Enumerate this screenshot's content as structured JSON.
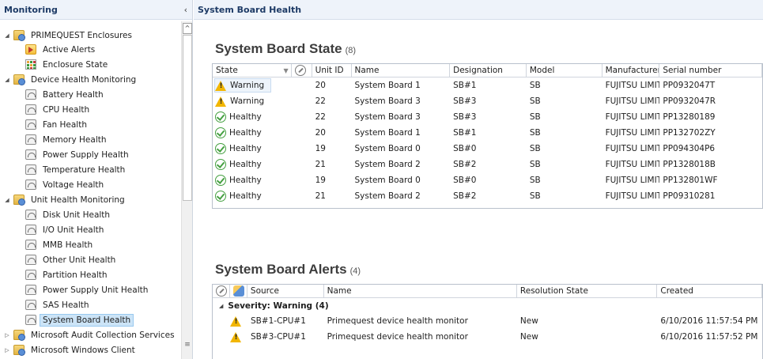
{
  "nav": {
    "title": "Monitoring",
    "collapse_glyph": "‹",
    "tree": [
      {
        "label": "PRIMEQUEST Enclosures",
        "icon": "folder-icon",
        "expander": "◢"
      },
      {
        "label": "Active Alerts",
        "icon": "alert-view-icon"
      },
      {
        "label": "Enclosure State",
        "icon": "state-view-icon"
      },
      {
        "label": "Device Health Monitoring",
        "icon": "folder-icon",
        "expander": "◢"
      },
      {
        "label": "Battery Health",
        "icon": "dashboard-icon"
      },
      {
        "label": "CPU Health",
        "icon": "dashboard-icon"
      },
      {
        "label": "Fan Health",
        "icon": "dashboard-icon"
      },
      {
        "label": "Memory Health",
        "icon": "dashboard-icon"
      },
      {
        "label": "Power Supply Health",
        "icon": "dashboard-icon"
      },
      {
        "label": "Temperature Health",
        "icon": "dashboard-icon"
      },
      {
        "label": "Voltage Health",
        "icon": "dashboard-icon"
      },
      {
        "label": "Unit Health Monitoring",
        "icon": "folder-icon",
        "expander": "◢"
      },
      {
        "label": "Disk Unit Health",
        "icon": "dashboard-icon"
      },
      {
        "label": "I/O Unit Health",
        "icon": "dashboard-icon"
      },
      {
        "label": "MMB Health",
        "icon": "dashboard-icon"
      },
      {
        "label": "Other Unit Health",
        "icon": "dashboard-icon"
      },
      {
        "label": "Partition Health",
        "icon": "dashboard-icon"
      },
      {
        "label": "Power Supply Unit Health",
        "icon": "dashboard-icon"
      },
      {
        "label": "SAS Health",
        "icon": "dashboard-icon"
      },
      {
        "label": "System Board Health",
        "icon": "dashboard-icon",
        "selected": true
      },
      {
        "label": "Microsoft Audit Collection Services",
        "icon": "folder-icon",
        "expander": "▷"
      },
      {
        "label": "Microsoft Windows Client",
        "icon": "folder-icon",
        "expander": "▷"
      }
    ],
    "scroll_up_glyph": "^",
    "scroll_grip_glyph": "≡"
  },
  "content": {
    "title": "System Board Health",
    "state_section": {
      "title": "System Board State",
      "count": "(8)",
      "columns": [
        "State",
        "",
        "Unit ID",
        "Name",
        "Designation",
        "Model",
        "Manufacturer",
        "Serial number"
      ],
      "sort_glyph": "▼",
      "rows": [
        {
          "state": "Warning",
          "status": "warning",
          "unit_id": "20",
          "name": "System Board 1",
          "designation": "SB#1",
          "model": "SB",
          "manufacturer": "FUJITSU LIMITED",
          "serial": "PP0932047T",
          "selected": true
        },
        {
          "state": "Warning",
          "status": "warning",
          "unit_id": "22",
          "name": "System Board 3",
          "designation": "SB#3",
          "model": "SB",
          "manufacturer": "FUJITSU LIMITED",
          "serial": "PP0932047R"
        },
        {
          "state": "Healthy",
          "status": "healthy",
          "unit_id": "22",
          "name": "System Board 3",
          "designation": "SB#3",
          "model": "SB",
          "manufacturer": "FUJITSU LIMITED",
          "serial": "PP13280189"
        },
        {
          "state": "Healthy",
          "status": "healthy",
          "unit_id": "20",
          "name": "System Board 1",
          "designation": "SB#1",
          "model": "SB",
          "manufacturer": "FUJITSU LIMITED",
          "serial": "PP132702ZY"
        },
        {
          "state": "Healthy",
          "status": "healthy",
          "unit_id": "19",
          "name": "System Board 0",
          "designation": "SB#0",
          "model": "SB",
          "manufacturer": "FUJITSU LIMITED",
          "serial": "PP094304P6"
        },
        {
          "state": "Healthy",
          "status": "healthy",
          "unit_id": "21",
          "name": "System Board 2",
          "designation": "SB#2",
          "model": "SB",
          "manufacturer": "FUJITSU LIMITED",
          "serial": "PP1328018B"
        },
        {
          "state": "Healthy",
          "status": "healthy",
          "unit_id": "19",
          "name": "System Board 0",
          "designation": "SB#0",
          "model": "SB",
          "manufacturer": "FUJITSU LIMITED",
          "serial": "PP132801WF"
        },
        {
          "state": "Healthy",
          "status": "healthy",
          "unit_id": "21",
          "name": "System Board 2",
          "designation": "SB#2",
          "model": "SB",
          "manufacturer": "FUJITSU LIMITED",
          "serial": "PP09310281"
        }
      ]
    },
    "alerts_section": {
      "title": "System Board Alerts",
      "count": "(4)",
      "columns": [
        "",
        "",
        "Source",
        "Name",
        "Resolution State",
        "Created"
      ],
      "group_label": "Severity: Warning (4)",
      "group_expander": "◢",
      "rows": [
        {
          "source": "SB#1-CPU#1",
          "name": "Primequest device health monitor",
          "resolution": "New",
          "created": "6/10/2016 11:57:54 PM"
        },
        {
          "source": "SB#3-CPU#1",
          "name": "Primequest device health monitor",
          "resolution": "New",
          "created": "6/10/2016 11:57:52 PM"
        }
      ]
    }
  },
  "colors": {
    "header_bg": "#eef3fa",
    "header_text": "#1e3b66",
    "selection": "#cce4f7",
    "warning": "#f2b602",
    "healthy": "#45a041"
  }
}
